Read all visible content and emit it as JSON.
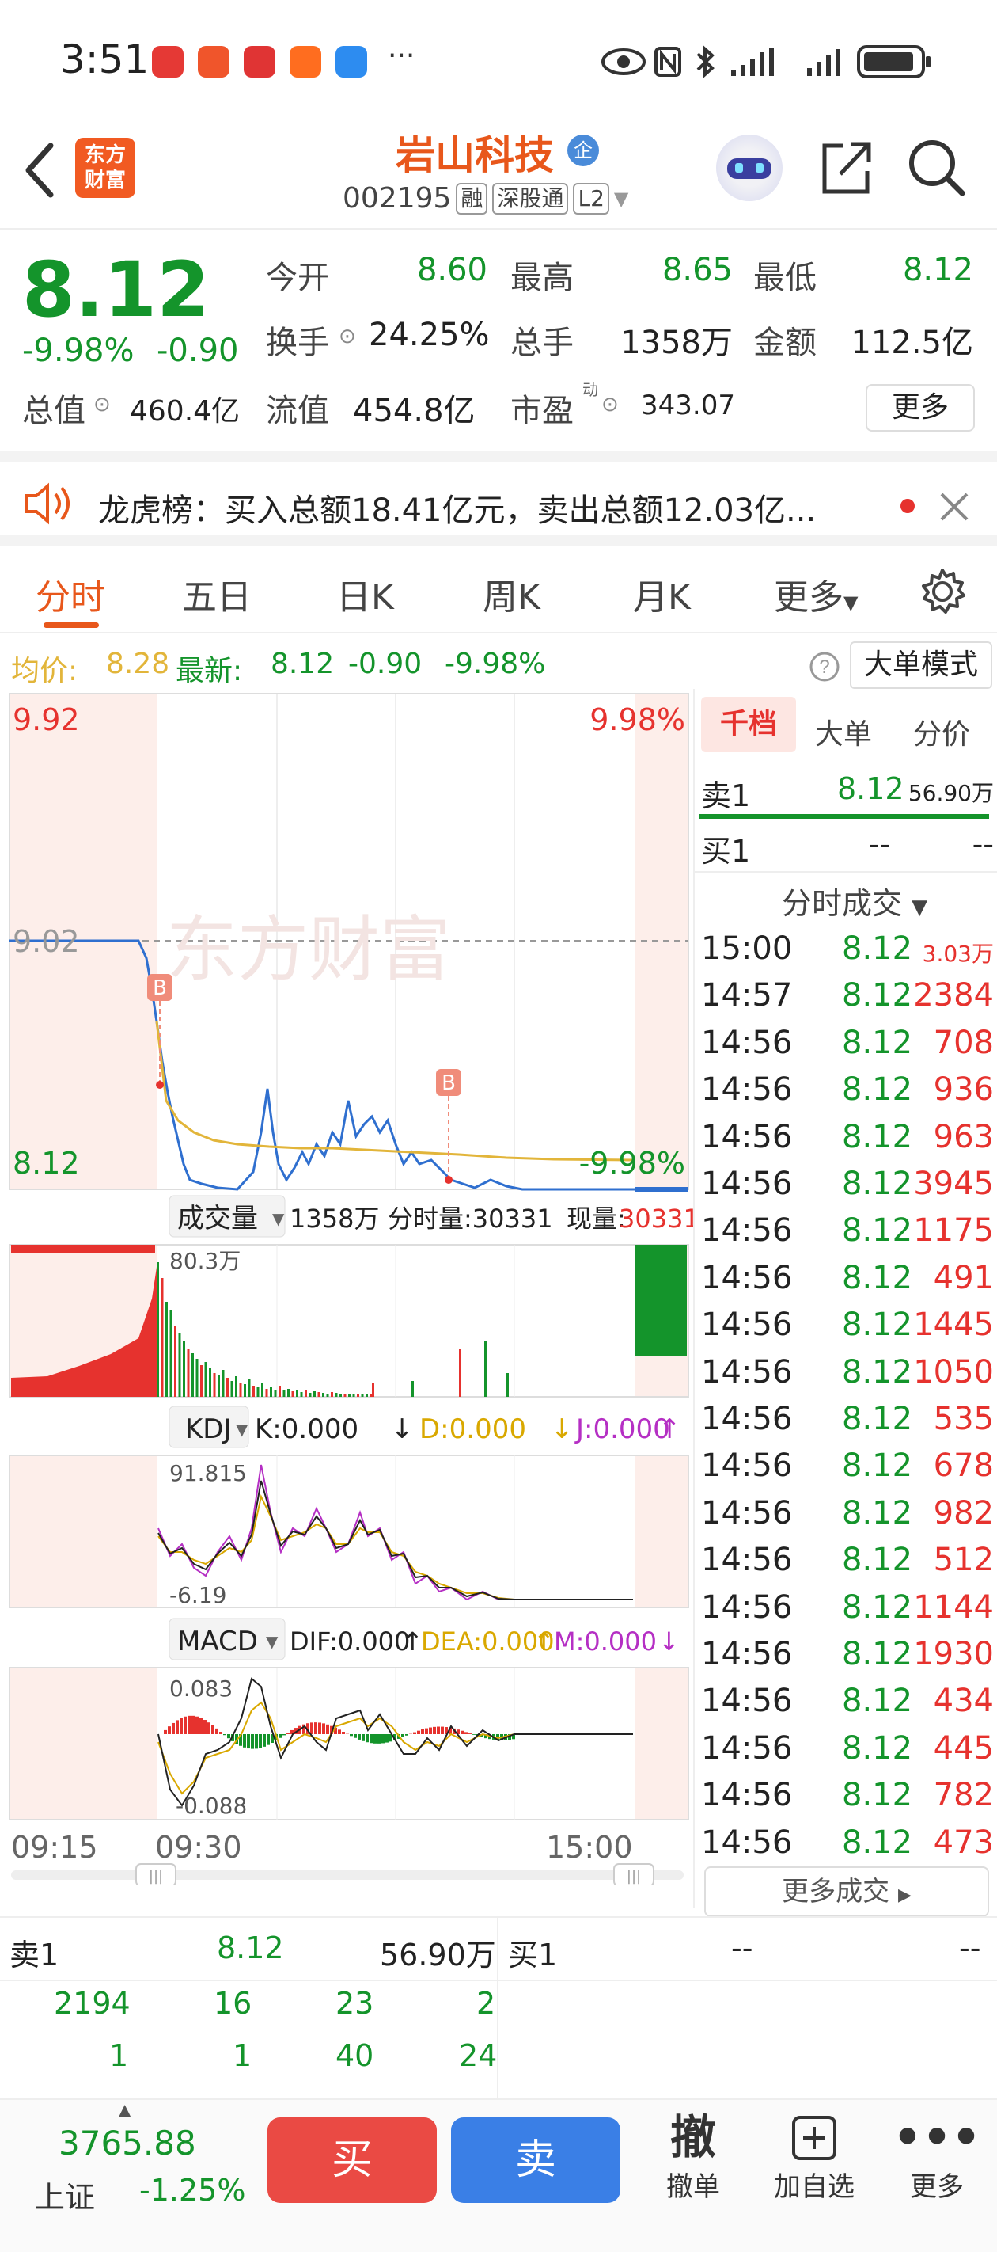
{
  "status_bar": {
    "time": "3:51",
    "dots": "···"
  },
  "header": {
    "stock_name": "岩山科技",
    "corp_badge": "企",
    "code": "002195",
    "tags": [
      "融",
      "深股通",
      "L2"
    ],
    "logo_text": [
      "东方",
      "财富"
    ]
  },
  "quote": {
    "price": "8.12",
    "change_pct": "-9.98%",
    "change": "-0.90",
    "fields": [
      {
        "label": "今开",
        "value": "8.60",
        "color": "green"
      },
      {
        "label": "最高",
        "value": "8.65",
        "color": "green"
      },
      {
        "label": "最低",
        "value": "8.12",
        "color": "green"
      },
      {
        "label": "换手",
        "value": "24.25%",
        "color": "dark"
      },
      {
        "label": "总手",
        "value": "1358万",
        "color": "dark"
      },
      {
        "label": "金额",
        "value": "112.5亿",
        "color": "dark"
      },
      {
        "label": "总值",
        "value": "460.4亿",
        "color": "dark"
      },
      {
        "label": "流值",
        "value": "454.8亿",
        "color": "dark"
      },
      {
        "label": "市盈",
        "value": "343.07",
        "color": "dark",
        "sup": "动"
      }
    ],
    "more_label": "更多"
  },
  "notice": {
    "text": "龙虎榜：买入总额18.41亿元，卖出总额12.03亿..."
  },
  "tabs": [
    "分时",
    "五日",
    "日K",
    "周K",
    "月K",
    "更多"
  ],
  "avg_bar": {
    "avg_label": "均价:",
    "avg_value": "8.28",
    "latest_label": "最新:",
    "latest_value": "8.12",
    "change": "-0.90",
    "change_pct": "-9.98%",
    "big_order_label": "大单模式"
  },
  "chart_data": {
    "type": "line",
    "price_high": "9.92",
    "price_low": "8.12",
    "price_prev": "9.02",
    "pct_high": "9.98%",
    "pct_low": "-9.98%",
    "watermark": "东方财富",
    "time_labels": [
      "09:15",
      "09:30",
      "15:00"
    ],
    "volume": {
      "selector": "成交量",
      "total": "1358万",
      "minute_label": "分时量:30331",
      "current_label": "现量:",
      "current_value": "30331",
      "max_label": "80.3万"
    },
    "kdj": {
      "selector": "KDJ",
      "k": "K:0.000",
      "d": "D:0.000",
      "j": "J:0.000",
      "max_label": "91.815",
      "min_label": "-6.19"
    },
    "macd": {
      "selector": "MACD",
      "dif": "DIF:0.000",
      "dea": "DEA:0.000",
      "m": "M:0.000",
      "max_label": "0.083",
      "min_label": "-0.088"
    },
    "marker": "B",
    "colors": {
      "price_line": "#2f6fcf",
      "avg_line": "#e2b53a",
      "up": "#e6322e",
      "down": "#14942b"
    }
  },
  "book": {
    "tabs": [
      "千档",
      "大单",
      "分价"
    ],
    "sell1": {
      "label": "卖1",
      "price": "8.12",
      "vol": "56.90万"
    },
    "buy1": {
      "label": "买1",
      "price": "--",
      "vol": "--"
    },
    "trades_title": "分时成交",
    "trades": [
      {
        "time": "15:00",
        "price": "8.12",
        "vol": "3.03万"
      },
      {
        "time": "14:57",
        "price": "8.12",
        "vol": "2384"
      },
      {
        "time": "14:56",
        "price": "8.12",
        "vol": "708"
      },
      {
        "time": "14:56",
        "price": "8.12",
        "vol": "936"
      },
      {
        "time": "14:56",
        "price": "8.12",
        "vol": "963"
      },
      {
        "time": "14:56",
        "price": "8.12",
        "vol": "3945"
      },
      {
        "time": "14:56",
        "price": "8.12",
        "vol": "1175"
      },
      {
        "time": "14:56",
        "price": "8.12",
        "vol": "491"
      },
      {
        "time": "14:56",
        "price": "8.12",
        "vol": "1445"
      },
      {
        "time": "14:56",
        "price": "8.12",
        "vol": "1050"
      },
      {
        "time": "14:56",
        "price": "8.12",
        "vol": "535"
      },
      {
        "time": "14:56",
        "price": "8.12",
        "vol": "678"
      },
      {
        "time": "14:56",
        "price": "8.12",
        "vol": "982"
      },
      {
        "time": "14:56",
        "price": "8.12",
        "vol": "512"
      },
      {
        "time": "14:56",
        "price": "8.12",
        "vol": "1144"
      },
      {
        "time": "14:56",
        "price": "8.12",
        "vol": "1930"
      },
      {
        "time": "14:56",
        "price": "8.12",
        "vol": "434"
      },
      {
        "time": "14:56",
        "price": "8.12",
        "vol": "445"
      },
      {
        "time": "14:56",
        "price": "8.12",
        "vol": "782"
      },
      {
        "time": "14:56",
        "price": "8.12",
        "vol": "473"
      }
    ],
    "more_trades": "更多成交"
  },
  "orders": {
    "sell_label": "卖1",
    "sell_price": "8.12",
    "sell_vol": "56.90万",
    "buy_label": "买1",
    "buy_price": "--",
    "buy_vol": "--",
    "row1": [
      "2194",
      "16",
      "23",
      "2"
    ],
    "row2": [
      "1",
      "1",
      "40",
      "24"
    ]
  },
  "bottom": {
    "index_value": "3765.88",
    "index_name": "上证",
    "index_change": "-1.25%",
    "buy": "买",
    "sell": "卖",
    "cancel": "撤单",
    "cancel_icon": "撤",
    "add": "加自选",
    "more": "更多"
  }
}
